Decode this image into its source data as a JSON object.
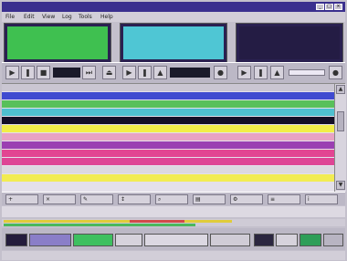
{
  "app": {
    "title": "",
    "window_buttons": [
      "_",
      "□",
      "×"
    ]
  },
  "menu": {
    "items": [
      "File",
      "Edit",
      "View",
      "Log",
      "Tools",
      "Help"
    ]
  },
  "players": [
    {
      "color": "#3fc050",
      "dark": false,
      "lines": [
        "",
        "",
        "",
        ""
      ]
    },
    {
      "color": "#4fc6d4",
      "dark": false,
      "lines": [
        "",
        "",
        "",
        ""
      ]
    },
    {
      "color": "#241c44",
      "dark": true,
      "lines": [
        "",
        "",
        "",
        ""
      ]
    }
  ],
  "transport": {
    "lcd_left": "",
    "lcd_right": "",
    "icons": [
      "play-icon",
      "pause-icon",
      "stop-icon",
      "skip-icon",
      "eject-icon",
      "record-icon",
      "cue-icon",
      "next-icon",
      "prev-icon",
      "loop-icon"
    ]
  },
  "playlist": {
    "columns": [
      "",
      "",
      "",
      "",
      "",
      ""
    ],
    "rows": [
      {
        "bg": "#3f4ad0",
        "fg": "#ffffff",
        "cells": [
          "",
          "",
          "",
          "",
          "",
          ""
        ]
      },
      {
        "bg": "#58c05a",
        "fg": "#10200e",
        "cells": [
          "",
          "",
          "",
          "",
          "",
          ""
        ]
      },
      {
        "bg": "#4fc0cf",
        "fg": "#0e1a20",
        "cells": [
          "",
          "",
          "",
          "",
          "",
          ""
        ]
      },
      {
        "bg": "#151026",
        "fg": "#e0e0ff",
        "cells": [
          "",
          "",
          "",
          "",
          "",
          ""
        ]
      },
      {
        "bg": "#f2ee48",
        "fg": "#202010",
        "cells": [
          "",
          "",
          "",
          "",
          "",
          ""
        ]
      },
      {
        "bg": "#e8a2c4",
        "fg": "#3a1020",
        "cells": [
          "",
          "",
          "",
          "",
          "",
          ""
        ]
      },
      {
        "bg": "#9b3fb2",
        "fg": "#ffffff",
        "cells": [
          "",
          "",
          "",
          "",
          "",
          ""
        ]
      },
      {
        "bg": "#e24592",
        "fg": "#ffffff",
        "cells": [
          "",
          "",
          "",
          "",
          "",
          ""
        ]
      },
      {
        "bg": "#de4595",
        "fg": "#ffffff",
        "cells": [
          "",
          "",
          "",
          "",
          "",
          ""
        ]
      },
      {
        "bg": "#dcd8e0",
        "fg": "#222222",
        "cells": [
          "",
          "",
          "",
          "",
          "",
          ""
        ]
      },
      {
        "bg": "#f2ec52",
        "fg": "#202010",
        "cells": [
          "",
          "",
          "",
          "",
          "",
          ""
        ]
      },
      {
        "bg": "#e4e0ea",
        "fg": "#222222",
        "cells": [
          "",
          "",
          "",
          "",
          "",
          ""
        ]
      }
    ]
  },
  "command_bar": {
    "buttons": [
      {
        "icon": "add-icon",
        "label": ""
      },
      {
        "icon": "delete-icon",
        "label": ""
      },
      {
        "icon": "edit-icon",
        "label": ""
      },
      {
        "icon": "move-icon",
        "label": ""
      },
      {
        "icon": "search-icon",
        "label": ""
      },
      {
        "icon": "save-icon",
        "label": ""
      },
      {
        "icon": "settings-icon",
        "label": ""
      },
      {
        "icon": "log-icon",
        "label": ""
      },
      {
        "icon": "info-icon",
        "label": ""
      }
    ]
  },
  "info_line": "",
  "status": {
    "left": "",
    "center": "",
    "right": ""
  }
}
